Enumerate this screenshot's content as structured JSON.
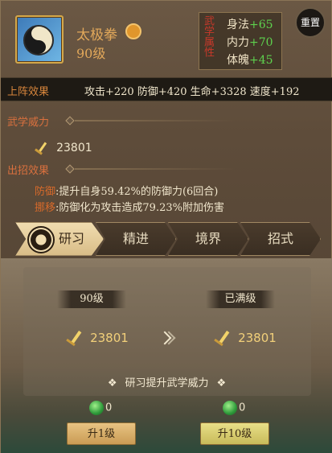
{
  "header": {
    "skill_name": "太极拳",
    "skill_level": "90级",
    "attributes_title": "武学属性",
    "attributes": [
      {
        "name": "身法",
        "bonus": "+65"
      },
      {
        "name": "内力",
        "bonus": "+70"
      },
      {
        "name": "体魄",
        "bonus": "+45"
      }
    ],
    "reset_label": "重置"
  },
  "deploy": {
    "label": "上阵效果",
    "value": "攻击+220 防御+420 生命+3328 速度+192"
  },
  "power_section": {
    "title": "武学威力",
    "value": "23801"
  },
  "effects_section": {
    "title": "出招效果",
    "lines": [
      {
        "name": "防御",
        "text": ":提升自身59.42%的防御力(6回合)"
      },
      {
        "name": "挪移",
        "text": ":防御化为攻击造成79.23%附加伤害"
      }
    ]
  },
  "tabs": [
    {
      "label": "研习",
      "active": true
    },
    {
      "label": "精进",
      "active": false
    },
    {
      "label": "境界",
      "active": false
    },
    {
      "label": "招式",
      "active": false
    }
  ],
  "study": {
    "current_level": "90级",
    "next_level": "已满级",
    "current_power": "23801",
    "next_power": "23801",
    "hint": "研习提升武学威力",
    "hint_deco": "❖",
    "cost_one": "0",
    "cost_ten": "0",
    "btn_one_label": "升1级",
    "btn_ten_label": "升10级"
  },
  "colors": {
    "accent_orange": "#e2a85a",
    "bonus_green": "#5ed24e",
    "title_red": "#d9703e"
  }
}
